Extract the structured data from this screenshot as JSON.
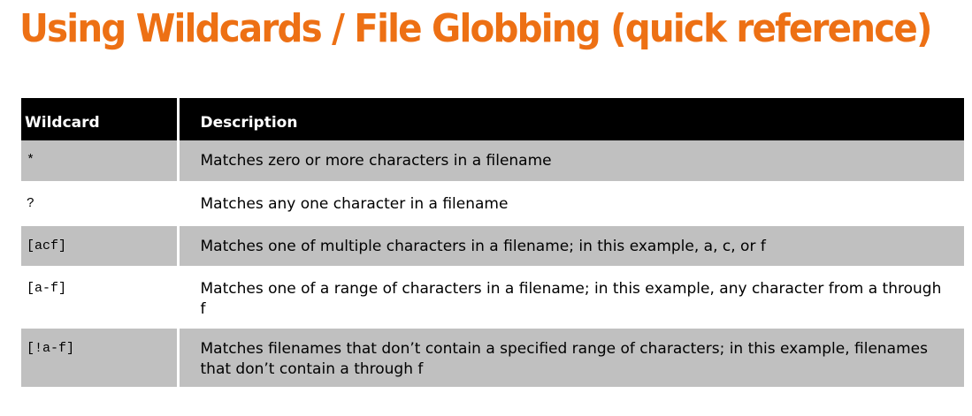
{
  "title": "Using Wildcards / File Globbing (quick reference)",
  "table": {
    "headers": {
      "wildcard": "Wildcard",
      "description": "Description"
    },
    "rows": [
      {
        "wildcard": "*",
        "description": "Matches zero or more characters in a filename"
      },
      {
        "wildcard": "?",
        "description": "Matches any one character in a filename"
      },
      {
        "wildcard": "[acf]",
        "description": "Matches one of multiple characters in a filename; in this example, a, c, or f"
      },
      {
        "wildcard": "[a-f]",
        "description": "Matches one of a range of characters in a filename; in this example, any character from a through f"
      },
      {
        "wildcard": "[!a-f]",
        "description": "Matches filenames that don’t contain a specified range of characters; in this example, filenames that don’t contain a through f"
      }
    ]
  },
  "colors": {
    "title": "#ed7014",
    "header_bg": "#000000",
    "shaded_row": "#c0c0c0"
  }
}
